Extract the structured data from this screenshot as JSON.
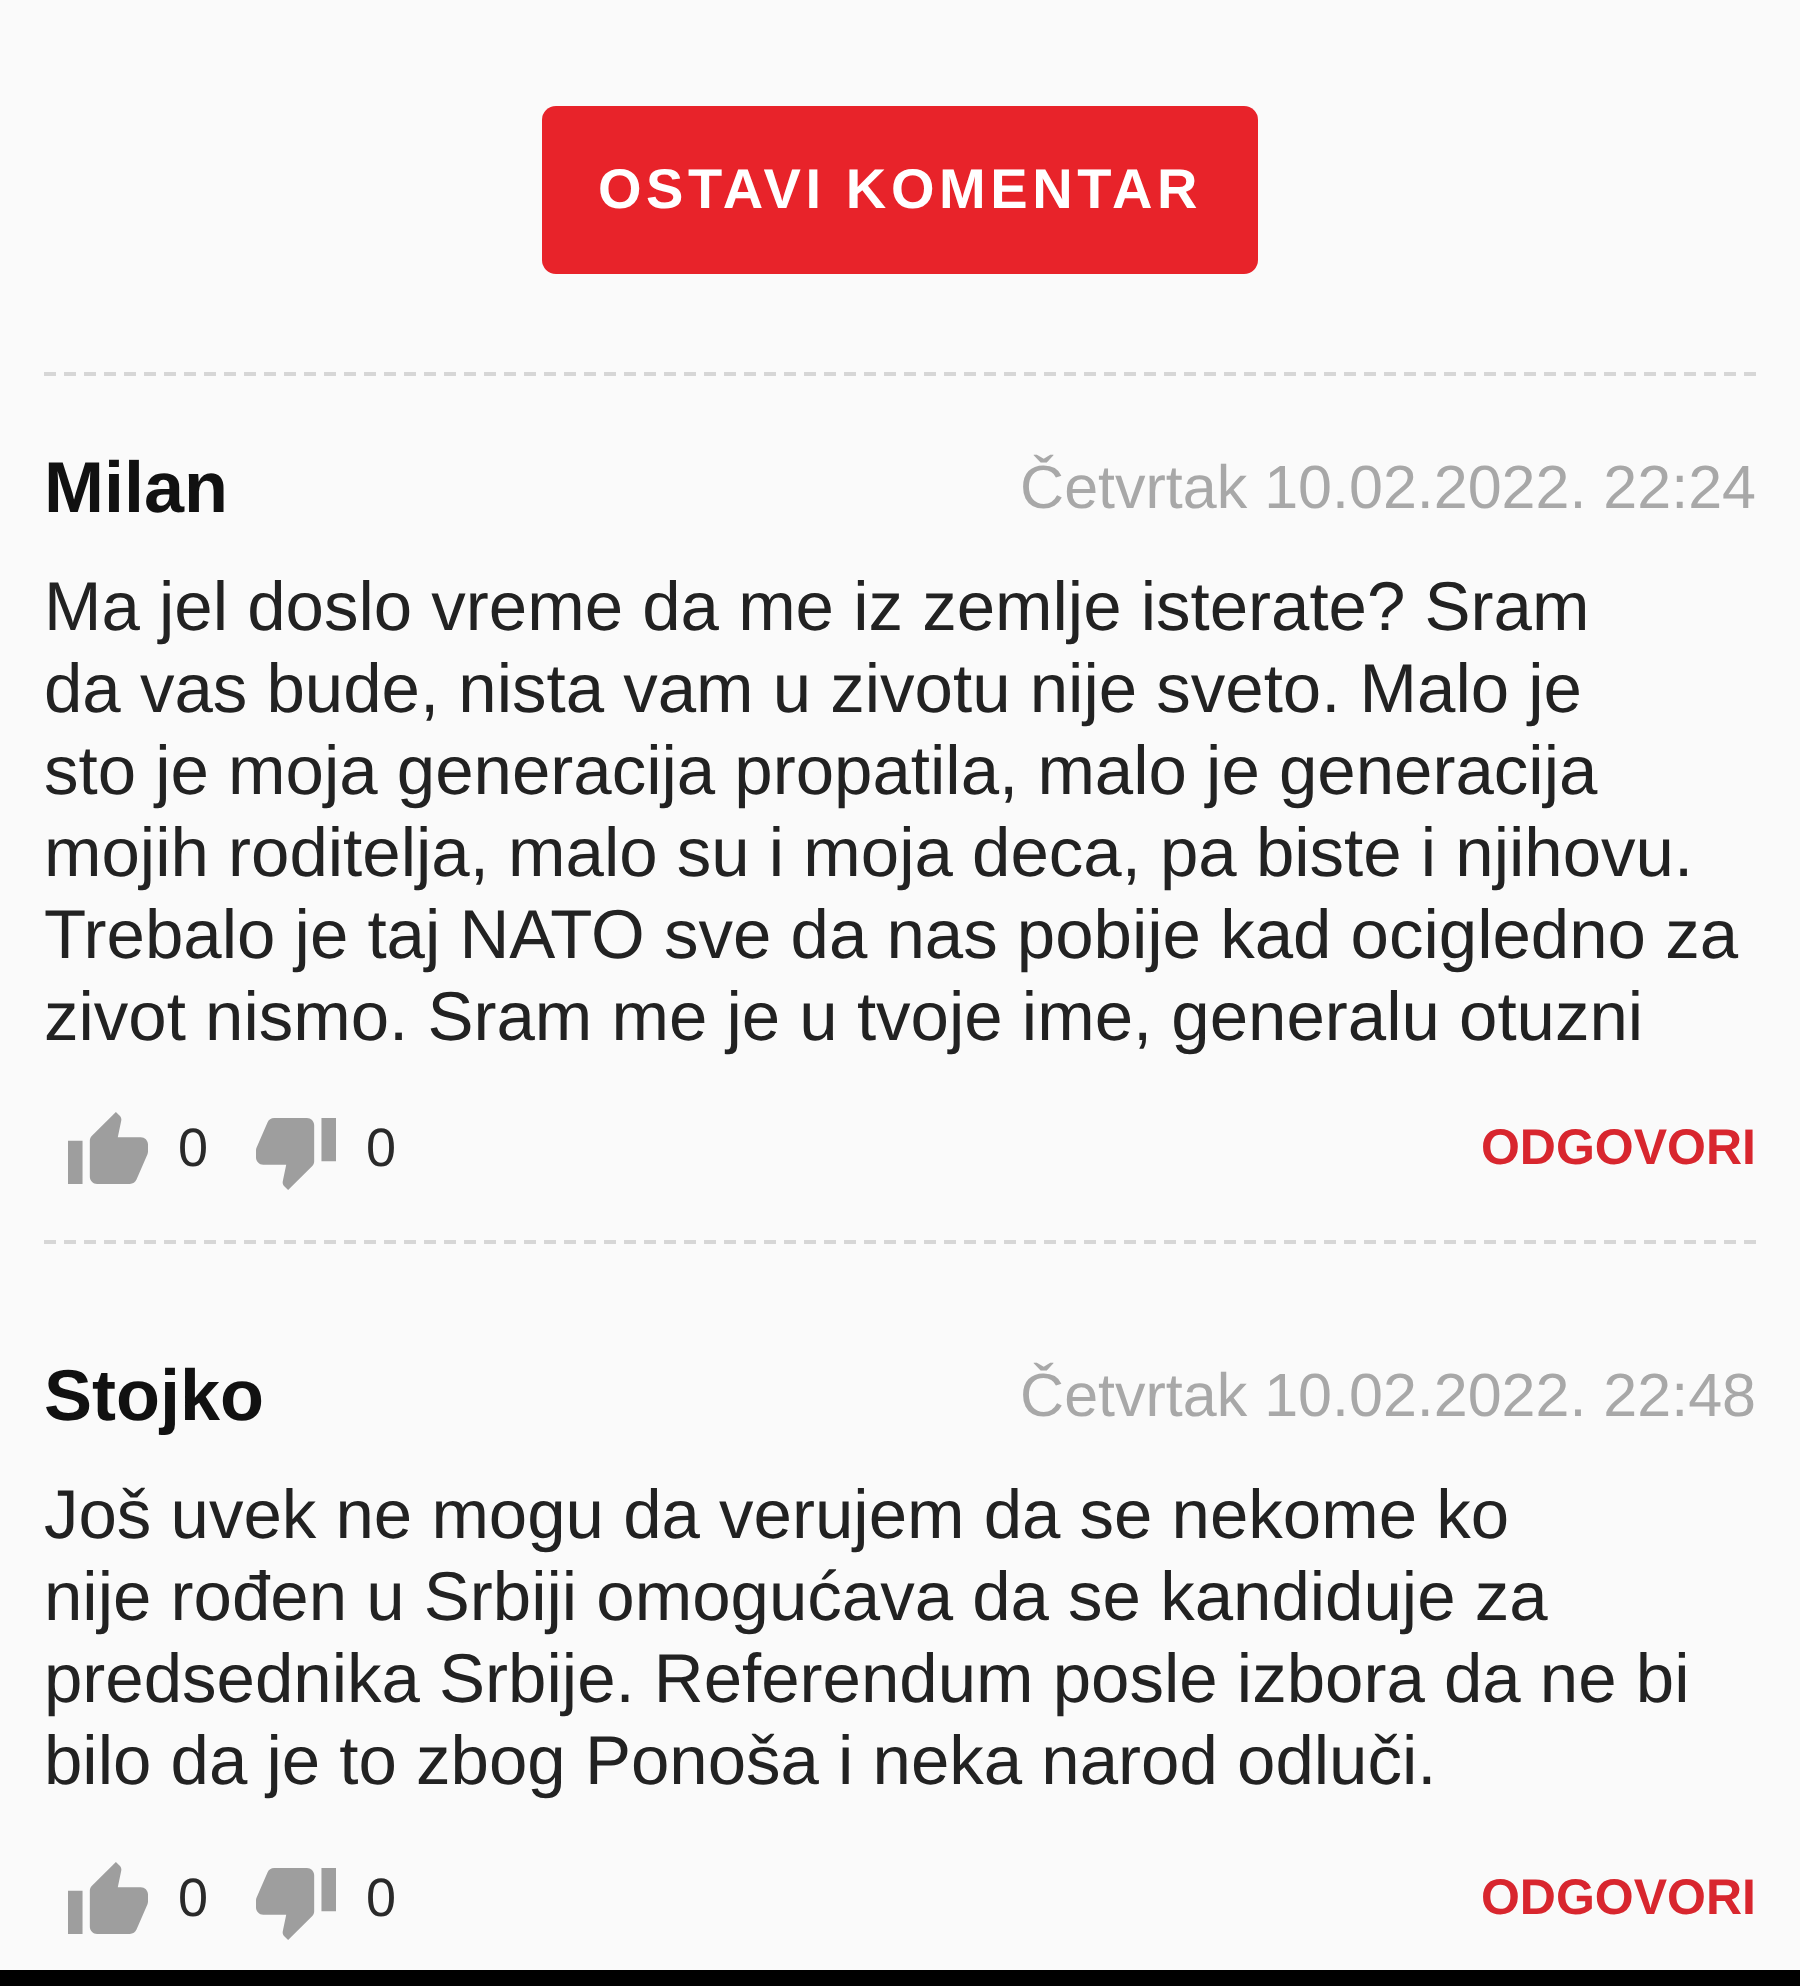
{
  "comment_button": {
    "label": "OSTAVI KOMENTAR"
  },
  "comments": [
    {
      "author": "Milan",
      "date": "Četvrtak 10.02.2022. 22:24",
      "text": "Ma jel doslo vreme da me iz zemlje isterate? Sram\nda vas bude, nista vam u zivotu nije sveto. Malo je\nsto je moja generacija propatila, malo je generacija\nmojih roditelja, malo su i moja deca, pa biste i njihovu.\nTrebalo je taj NATO sve da nas pobije kad ocigledno za\nzivot nismo. Sram me je u tvoje ime, generalu otuzni",
      "likes": "0",
      "dislikes": "0",
      "reply": "ODGOVORI"
    },
    {
      "author": "Stojko",
      "date": "Četvrtak 10.02.2022. 22:48",
      "text": "Još uvek ne mogu da verujem da se nekome ko\nnije rođen u Srbiji omogućava da se kandiduje za\npredsednika Srbije. Referendum posle izbora da ne bi\nbilo da je to zbog Ponoša i neka narod odluči.",
      "likes": "0",
      "dislikes": "0",
      "reply": "ODGOVORI"
    }
  ]
}
